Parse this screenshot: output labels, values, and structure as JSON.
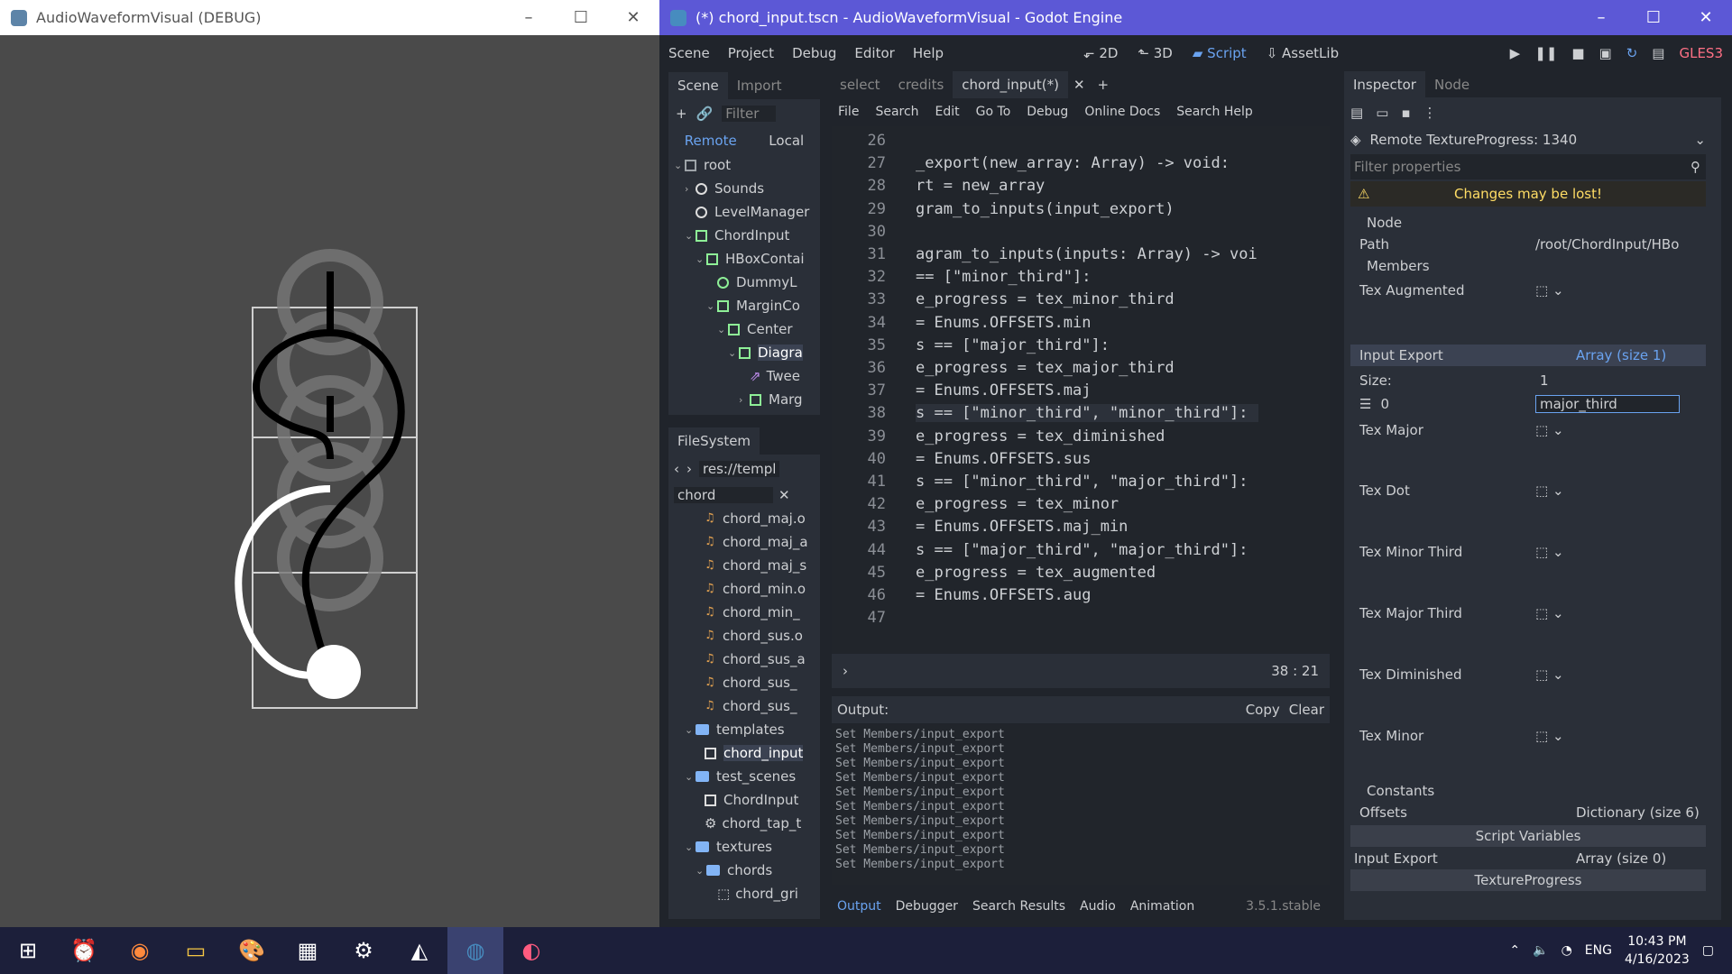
{
  "debug_window": {
    "title": "AudioWaveformVisual (DEBUG)"
  },
  "godot_window": {
    "title": "(*) chord_input.tscn - AudioWaveformVisual - Godot Engine"
  },
  "menu": {
    "items": [
      "Scene",
      "Project",
      "Debug",
      "Editor",
      "Help"
    ],
    "center": [
      "2D",
      "3D",
      "Script",
      "AssetLib"
    ],
    "renderer": "GLES3"
  },
  "scene_dock": {
    "tabs": [
      "Scene",
      "Import"
    ],
    "filter_placeholder": "Filter",
    "remote": "Remote",
    "local": "Local",
    "tree": [
      "root",
      "Sounds",
      "LevelManager",
      "ChordInput",
      "HBoxContai",
      "DummyL",
      "MarginCo",
      "Center",
      "Diagra",
      "Twee",
      "Marg"
    ]
  },
  "filesystem": {
    "title": "FileSystem",
    "path": "res://templ",
    "search": "chord",
    "files": [
      "chord_maj.o",
      "chord_maj_a",
      "chord_maj_s",
      "chord_min.o",
      "chord_min_",
      "chord_sus.o",
      "chord_sus_a",
      "chord_sus_",
      "chord_sus_",
      "templates",
      "chord_input",
      "test_scenes",
      "ChordInput",
      "chord_tap_t",
      "textures",
      "chords",
      "chord_gri"
    ]
  },
  "script_tabs": [
    "select",
    "credits",
    "chord_input(*)"
  ],
  "script_menu": [
    "File",
    "Search",
    "Edit",
    "Go To",
    "Debug",
    "Online Docs",
    "Search Help"
  ],
  "code": {
    "lines": [
      {
        "n": "26",
        "t": ""
      },
      {
        "n": "27",
        "t": "_export(new_array: Array) -> void:"
      },
      {
        "n": "28",
        "t": "rt = new_array"
      },
      {
        "n": "29",
        "t": "gram_to_inputs(input_export)"
      },
      {
        "n": "30",
        "t": ""
      },
      {
        "n": "31",
        "t": "agram_to_inputs(inputs: Array) -> voi"
      },
      {
        "n": "32",
        "t": "== [\"minor_third\"]:"
      },
      {
        "n": "33",
        "t": "e_progress = tex_minor_third"
      },
      {
        "n": "34",
        "t": "= Enums.OFFSETS.min"
      },
      {
        "n": "35",
        "t": "s == [\"major_third\"]:"
      },
      {
        "n": "36",
        "t": "e_progress = tex_major_third"
      },
      {
        "n": "37",
        "t": "= Enums.OFFSETS.maj"
      },
      {
        "n": "38",
        "t": "s == [\"minor_third\", \"minor_third\"]:"
      },
      {
        "n": "39",
        "t": "e_progress = tex_diminished"
      },
      {
        "n": "40",
        "t": "= Enums.OFFSETS.sus"
      },
      {
        "n": "41",
        "t": "s == [\"minor_third\", \"major_third\"]:"
      },
      {
        "n": "42",
        "t": "e_progress = tex_minor"
      },
      {
        "n": "43",
        "t": "= Enums.OFFSETS.maj_min"
      },
      {
        "n": "44",
        "t": "s == [\"major_third\", \"major_third\"]:"
      },
      {
        "n": "45",
        "t": "e_progress = tex_augmented"
      },
      {
        "n": "46",
        "t": "= Enums.OFFSETS.aug"
      },
      {
        "n": "47",
        "t": ""
      }
    ],
    "cursor": "38 :   21"
  },
  "output": {
    "label": "Output:",
    "copy": "Copy",
    "clear": "Clear",
    "line": "Set Members/input_export",
    "count": 10,
    "tabs": [
      "Output",
      "Debugger",
      "Search Results",
      "Audio",
      "Animation"
    ],
    "version": "3.5.1.stable"
  },
  "inspector": {
    "tabs": [
      "Inspector",
      "Node"
    ],
    "object": "Remote TextureProgress: 1340",
    "filter_placeholder": "Filter properties",
    "warning": "Changes may be lost!",
    "node": "Node",
    "path_label": "Path",
    "path_value": "/root/ChordInput/HBo",
    "members": "Members",
    "props": [
      "Tex Augmented",
      "Input Export",
      "Tex Major",
      "Tex Dot",
      "Tex Minor Third",
      "Tex Major Third",
      "Tex Diminished",
      "Tex Minor"
    ],
    "array_label": "Array (size 1)",
    "size_label": "Size:",
    "size_value": "1",
    "idx": "0",
    "elem_value": "major_third",
    "constants": "Constants",
    "offsets_label": "Offsets",
    "offsets_value": "Dictionary (size 6)",
    "script_vars": "Script Variables",
    "input_export2": "Input Export",
    "input_export2_value": "Array (size 0)",
    "texprog": "TextureProgress"
  },
  "taskbar": {
    "time": "10:43 PM",
    "date": "4/16/2023",
    "lang": "ENG"
  }
}
